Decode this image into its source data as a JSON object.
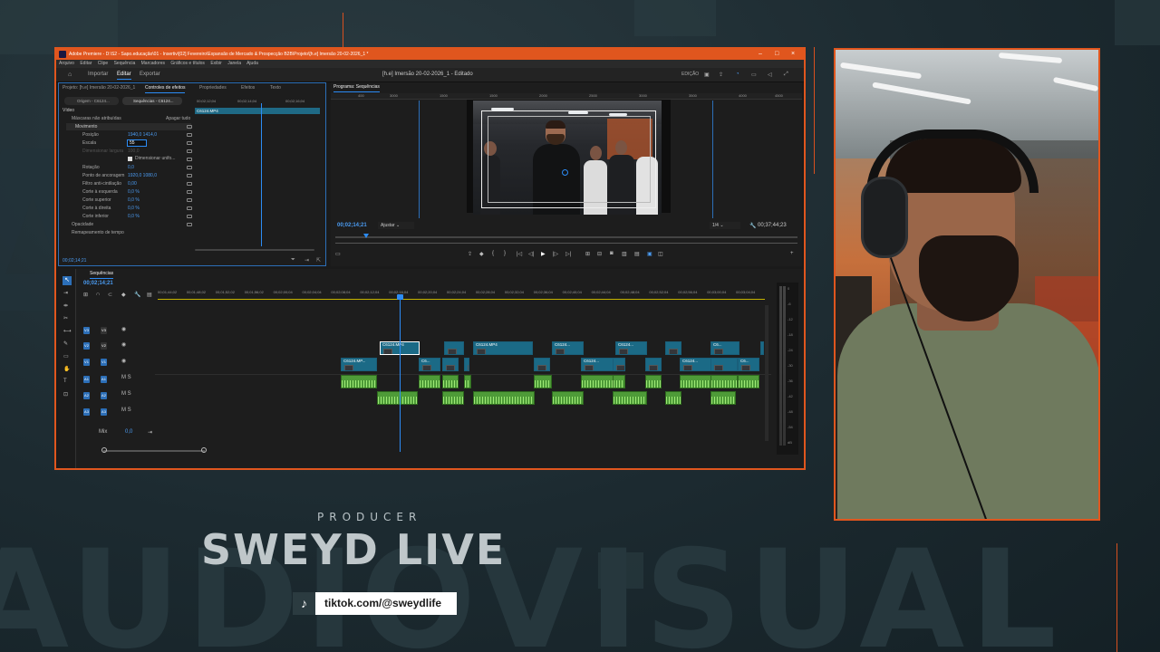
{
  "app": {
    "window_title": "Adobe Premiere - D:\\S2 - Sapo.educação\\01 - Insertiv\\[02] Fevereiro\\Expansão de Mercado & Prospecção B2B\\Projeto\\[h.e] Imersão 20-02-2026_1 *",
    "menu": [
      "Arquivo",
      "Editar",
      "Clipe",
      "Sequência",
      "Marcadores",
      "Gráficos e títulos",
      "Exibir",
      "Janela",
      "Ajuda"
    ],
    "workspaces": [
      "Importar",
      "Editar",
      "Exportar"
    ],
    "active_workspace": "Editar",
    "document_title": "[h.e] Imersão 20-02-2026_1 - Editado",
    "header_right": "EDIÇÃO"
  },
  "effect_controls": {
    "tabs": [
      "Projeto: [h.e] Imersão 20-02-2026_1",
      "Controles de efeitos",
      "Propriedades",
      "Efeitos",
      "Texto"
    ],
    "active_tab": "Controles de efeitos",
    "source_left": "Origem - C6124...",
    "source_right": "Sequências - C6124...",
    "mini_ruler": [
      "00;02;12;04",
      "00;02;14;04",
      "00;02;16;04"
    ],
    "clip_label": "C6124.MP4",
    "section_video": "Vídeo",
    "masks_label": "Máscaras não atribuídas",
    "reset_all": "Apagar tudo",
    "rows": [
      {
        "name": "Movimento",
        "value": ""
      },
      {
        "name": "Posição",
        "value": "1940,0    1414,0"
      },
      {
        "name": "Escala",
        "value": "55"
      },
      {
        "name": "Dimensionar largura",
        "value": "100,0"
      },
      {
        "name": "Dimensionar unifo...",
        "value": ""
      },
      {
        "name": "Rotação",
        "value": "0,0"
      },
      {
        "name": "Ponto de ancoragem",
        "value": "1920,0    1080,0"
      },
      {
        "name": "Filtro anti-cintilação",
        "value": "0,00"
      },
      {
        "name": "Corte à esquerda",
        "value": "0,0 %"
      },
      {
        "name": "Corte superior",
        "value": "0,0 %"
      },
      {
        "name": "Corte à direita",
        "value": "0,0 %"
      },
      {
        "name": "Corte inferior",
        "value": "0,0 %"
      },
      {
        "name": "Opacidade",
        "value": ""
      },
      {
        "name": "Remapeamento de tempo",
        "value": ""
      }
    ],
    "timecode": "00;02;14;21"
  },
  "program": {
    "title": "Programa: Sequências",
    "ruler": [
      "400",
      "3000",
      "1500",
      "1500",
      "2000",
      "2500",
      "3000",
      "3500",
      "4000",
      "4500"
    ],
    "timecode": "00;02;14;21",
    "fit": "Ajustar",
    "resolution": "1/4",
    "duration": "00;37;44;23"
  },
  "timeline": {
    "tab": "Sequências",
    "timecode": "00;02;14;21",
    "ruler": [
      "00;01;44;02",
      "00;01;48;02",
      "00;01;52;02",
      "00;01;56;02",
      "00;02;00;04",
      "00;02;04;04",
      "00;02;08;04",
      "00;02;12;04",
      "00;02;16;04",
      "00;02;20;04",
      "00;02;24;04",
      "00;02;28;04",
      "00;02;32;04",
      "00;02;36;04",
      "00;02;40;04",
      "00;02;44;04",
      "00;02;48;04",
      "00;02;52;04",
      "00;02;56;04",
      "00;03;00;04",
      "00;03;04;04"
    ],
    "video_tracks": [
      "V3",
      "V2",
      "V1"
    ],
    "audio_tracks": [
      "A1",
      "A2",
      "A3"
    ],
    "mix_label": "Mix",
    "mix_value": "0,0",
    "clip_names": [
      "C6124.MP4",
      "C6124.MP4",
      "C6124.MP4",
      "C6124...",
      "C6124...",
      "C6...",
      "C6124.MP...",
      "C6...",
      "C6124...",
      "C6124...",
      "C6..."
    ],
    "meter_labels": [
      "0",
      "-6",
      "-12",
      "-18",
      "-24",
      "-30",
      "-36",
      "-42",
      "-48",
      "-54",
      "dB"
    ]
  },
  "branding": {
    "producer": "PRODUCER",
    "title": "SWEYD LIVE",
    "background_word": "AUDIOVISUAL",
    "tiktok": "tiktok.com/@sweydlife"
  }
}
